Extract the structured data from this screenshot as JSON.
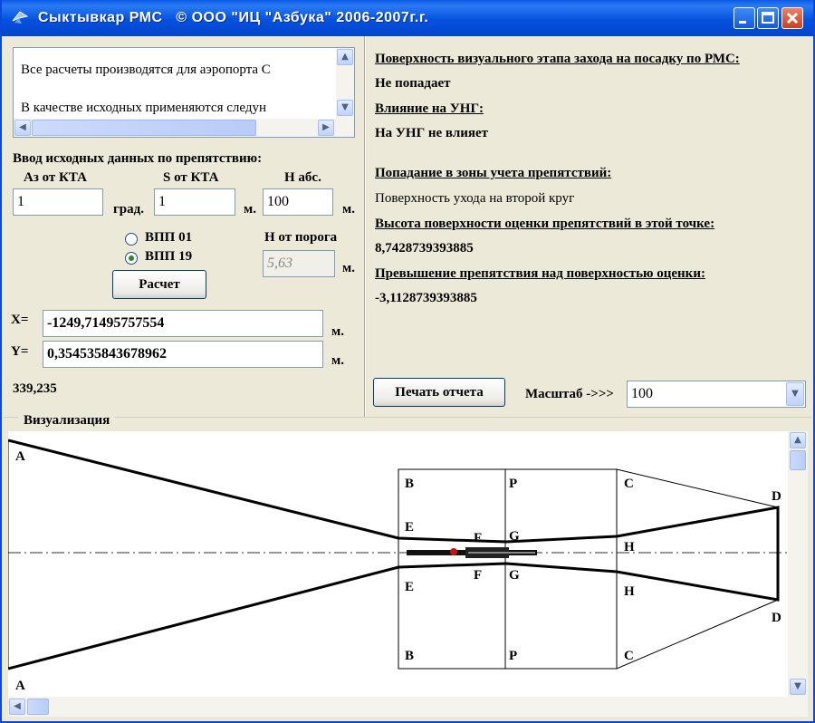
{
  "window": {
    "title": "Сыктывкар РМС   © ООО \"ИЦ \"Азбука\" 2006-2007г.г."
  },
  "memo": {
    "line1": "Все расчеты производятся для аэропорта С",
    "line2": "В качестве исходных применяются следун"
  },
  "input": {
    "section_title": "Ввод исходных данных по препятствию:",
    "az_label": "Аз от КТА",
    "az_value": "1",
    "az_unit": "град.",
    "s_label": "S от КТА",
    "s_value": "1",
    "s_unit": "м.",
    "h_label": "Н абс.",
    "h_value": "100",
    "h_unit": "м.",
    "runway1_label": "ВПП 01",
    "runway2_label": "ВПП 19",
    "runway_selected": "ВПП 19",
    "hthr_label": "Н от порога",
    "hthr_value": "5,63",
    "hthr_unit": "м.",
    "calc_button": "Расчет"
  },
  "coords": {
    "x_label": "X=",
    "x_value": "-1249,71495757554",
    "x_unit": "м.",
    "y_label": "Y=",
    "y_value": "0,354535843678962",
    "y_unit": "м.",
    "extra": "339,235"
  },
  "results": {
    "h1": "Поверхность визуального этапа захода на посадку по РМС:",
    "v1": "Не попадает",
    "h2": "Влияние на УНГ:",
    "v2": "На УНГ не влияет",
    "h3": "Попадание в зоны учета препятствий:",
    "v3": "Поверхность ухода на второй круг",
    "h4": "Высота поверхности оценки препятствий в этой точке:",
    "v4": "8,7428739393885",
    "h5": "Превышение препятствия над поверхностью оценки:",
    "v5": "-3,1128739393885"
  },
  "toolbar": {
    "print_button": "Печать отчета",
    "scale_label": "Масштаб ->>>",
    "scale_value": "100"
  },
  "viz": {
    "title": "Визуализация",
    "labels": {
      "A": "A",
      "B": "B",
      "P": "P",
      "C": "C",
      "D": "D",
      "E": "E",
      "F": "F",
      "G": "G",
      "H": "H"
    },
    "obstacle_color": "#CC1111"
  }
}
